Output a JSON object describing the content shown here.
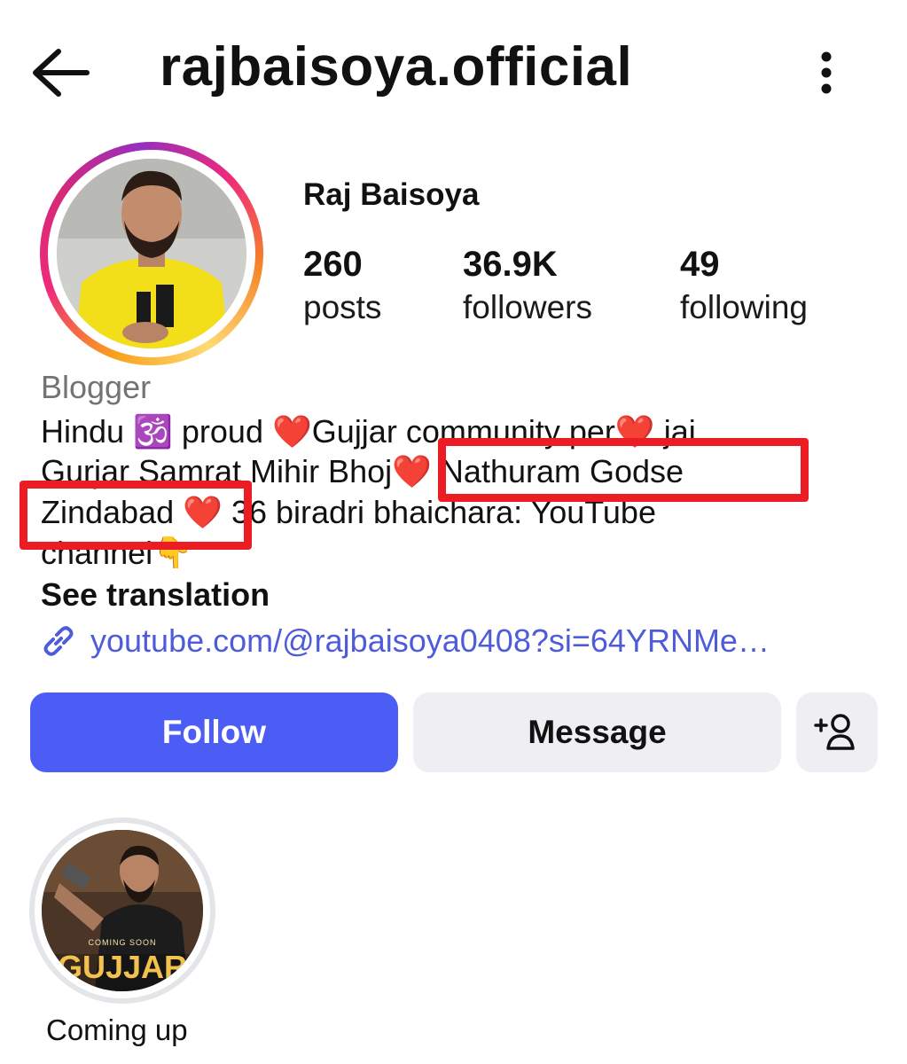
{
  "header": {
    "back_icon": "arrow-left-icon",
    "title": "rajbaisoya.official",
    "more_icon": "more-vertical-icon"
  },
  "profile": {
    "name": "Raj Baisoya",
    "stats": [
      {
        "value": "260",
        "label": "posts"
      },
      {
        "value": "36.9K",
        "label": "followers"
      },
      {
        "value": "49",
        "label": "following"
      }
    ],
    "category": "Blogger",
    "bio_lines": [
      "Hindu 🕉️ proud  ❤️Gujjar community per❤️ jai",
      "Gurjar Samrat Mihir Bhoj❤️ Nathuram Godse",
      "Zindabad ❤️ 36 biradri bhaichara: YouTube",
      "channel👇"
    ],
    "see_translation": "See translation",
    "link": "youtube.com/@rajbaisoya0408?si=64YRNMe…",
    "link_icon": "link-icon"
  },
  "actions": {
    "follow_label": "Follow",
    "message_label": "Message",
    "add_icon": "add-person-icon"
  },
  "highlights": [
    {
      "label": "Coming up",
      "cover_text": "GUJJAR",
      "cover_tag": "COMING SOON"
    }
  ],
  "colors": {
    "follow_button": "#4c5df6",
    "secondary_button": "#efeff3",
    "link": "#4f5cd9",
    "annotation_box": "#ec1c24",
    "category_text": "#737373"
  }
}
